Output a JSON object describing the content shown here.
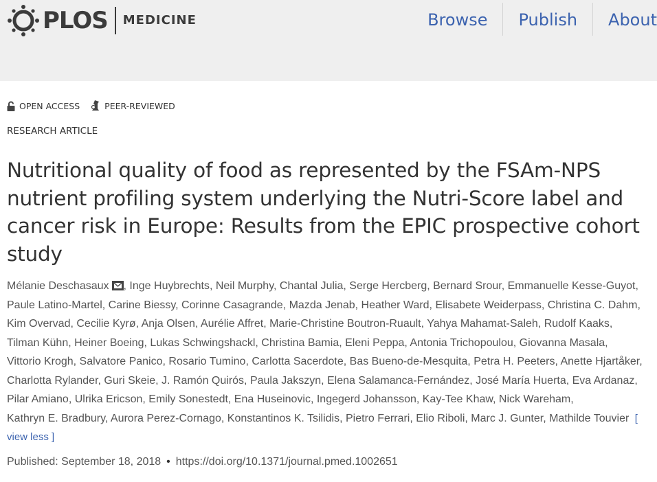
{
  "header": {
    "logo_text": "PLOS",
    "journal": "MEDICINE",
    "nav": [
      "Browse",
      "Publish",
      "About"
    ]
  },
  "badges": {
    "open_access": "OPEN ACCESS",
    "peer_reviewed": "PEER-REVIEWED"
  },
  "article": {
    "type": "RESEARCH ARTICLE",
    "title": "Nutritional quality of food as represented by the FSAm-NPS nutrient profiling system underlying the Nutri-Score label and cancer risk in Europe: Results from the EPIC prospective cohort study",
    "authors": [
      "Mélanie Deschasaux",
      "Inge Huybrechts",
      "Neil Murphy",
      "Chantal Julia",
      "Serge Hercberg",
      "Bernard Srour",
      "Emmanuelle Kesse-Guyot",
      "Paule Latino-Martel",
      "Carine Biessy",
      "Corinne Casagrande",
      "Mazda Jenab",
      "Heather Ward",
      "Elisabete Weiderpass",
      "Christina C. Dahm",
      "Kim Overvad",
      "Cecilie Kyrø",
      "Anja Olsen",
      "Aurélie Affret",
      "Marie-Christine Boutron-Ruault",
      "Yahya Mahamat-Saleh",
      "Rudolf Kaaks",
      "Tilman Kühn",
      "Heiner Boeing",
      "Lukas Schwingshackl",
      "Christina Bamia",
      "Eleni Peppa",
      "Antonia Trichopoulou",
      "Giovanna Masala",
      "Vittorio Krogh",
      "Salvatore Panico",
      "Rosario Tumino",
      "Carlotta Sacerdote",
      "Bas Bueno-de-Mesquita",
      "Petra H. Peeters",
      "Anette Hjartåker",
      "Charlotta Rylander",
      "Guri Skeie",
      "J. Ramón Quirós",
      "Paula Jakszyn",
      "Elena Salamanca-Fernández",
      "José María Huerta",
      "Eva Ardanaz",
      "Pilar Amiano",
      "Ulrika Ericson",
      "Emily Sonestedt",
      "Ena Huseinovic",
      "Ingegerd Johansson",
      "Kay-Tee Khaw",
      "Nick Wareham",
      "Kathryn E. Bradbury",
      "Aurora Perez-Cornago",
      "Konstantinos K. Tsilidis",
      "Pietro Ferrari",
      "Elio Riboli",
      "Marc J. Gunter",
      "Mathilde Touvier"
    ],
    "view_less": "[ view less ]",
    "published": "Published: September 18, 2018",
    "bullet": "•",
    "doi": "https://doi.org/10.1371/journal.pmed.1002651"
  },
  "colors": {
    "link": "#3c63af",
    "header_bg": "#efefef",
    "text": "#333333"
  },
  "icons": [
    "plos-logo-icon",
    "lock-open-icon",
    "peer-reviewed-icon",
    "mail-icon"
  ]
}
